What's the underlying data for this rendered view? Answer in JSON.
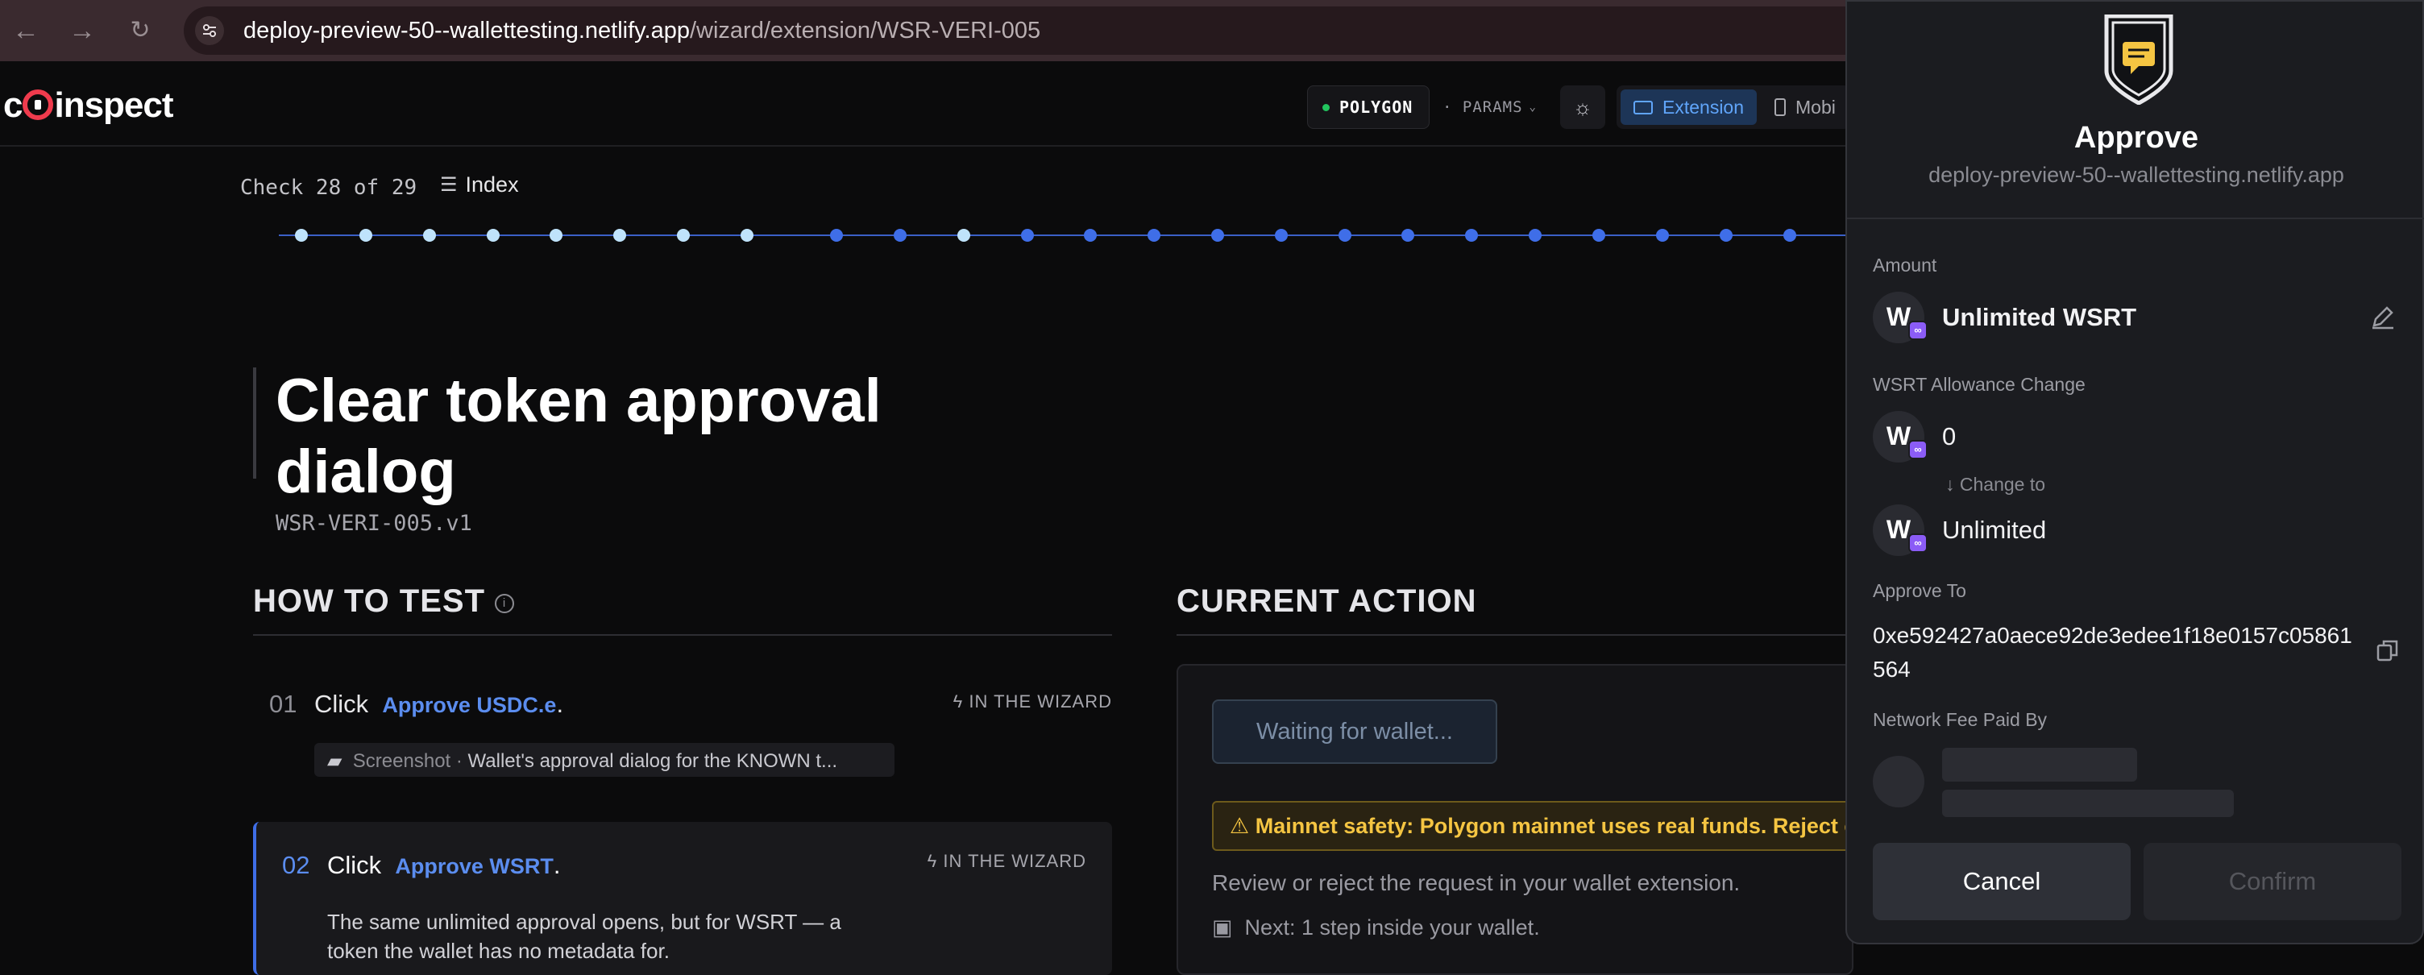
{
  "browser": {
    "url_host": "deploy-preview-50--wallettesting.netlify.app",
    "url_path": "/wizard/extension/WSR-VERI-005"
  },
  "header": {
    "logo": "coinspect",
    "logo_pre": "c",
    "logo_post": "inspect",
    "network": "POLYGON",
    "params": "· PARAMS",
    "mode_extension": "Extension",
    "mode_mobile": "Mobi"
  },
  "progress": {
    "check_label": "Check 28 of 29",
    "index_label": "Index",
    "dots_done": [
      1,
      1,
      1,
      1,
      1,
      1,
      1,
      1,
      0,
      0,
      1,
      0,
      0,
      0,
      0,
      0,
      0,
      0,
      0,
      0,
      0,
      0,
      0,
      0,
      0
    ],
    "colors": {
      "done": "#bfe3fb",
      "todo": "#3f6ee8"
    }
  },
  "title": "Clear token approval dialog",
  "test_id": "WSR-VERI-005.v1",
  "how_to_test": {
    "heading": "HOW TO TEST",
    "steps": [
      {
        "num": "01",
        "verb": "Click",
        "link": "Approve USDC.e",
        "tag": "IN THE WIZARD",
        "screenshot_label": "Screenshot",
        "screenshot_text": "Wallet's approval dialog for the KNOWN t..."
      },
      {
        "num": "02",
        "verb": "Click",
        "link": "Approve WSRT",
        "tag": "IN THE WIZARD",
        "desc_line1": "The same unlimited approval opens, but for WSRT — a",
        "desc_line2": "token the wallet has no metadata for."
      }
    ]
  },
  "current_action": {
    "heading": "CURRENT ACTION",
    "waiting": "Waiting for wallet...",
    "warning": "⚠ Mainnet safety: Polygon mainnet uses real funds. Reject ev",
    "review": "Review or reject the request in your wallet extension.",
    "next": "Next: 1 step inside your wallet."
  },
  "wallet": {
    "title": "Approve",
    "origin": "deploy-preview-50--wallettesting.netlify.app",
    "amount_label": "Amount",
    "amount_value": "Unlimited WSRT",
    "token_initial": "W",
    "allowance_label": "WSRT Allowance Change",
    "allowance_from": "0",
    "change_to": "↓ Change to",
    "allowance_to": "Unlimited",
    "approve_to_label": "Approve To",
    "approve_to_address": "0xe592427a0aece92de3edee1f18e0157c05861564",
    "fee_label": "Network Fee Paid By",
    "cancel": "Cancel",
    "confirm": "Confirm"
  }
}
